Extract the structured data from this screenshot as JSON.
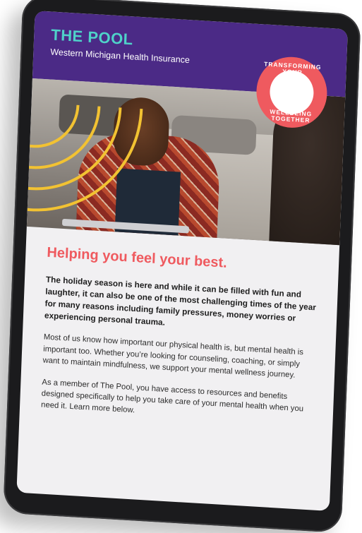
{
  "brand": {
    "name_part1": "THE ",
    "name_part2": "POOL",
    "subtitle": "Western Michigan Health Insurance"
  },
  "badge": {
    "text_top": "TRANSFORMING YOUR",
    "text_bottom": "WELLBEING TOGETHER"
  },
  "article": {
    "headline": "Helping you feel your best.",
    "lead": "The holiday season is here and while it can be filled with fun and laughter, it can also be one of the most challenging times of the year for many reasons including family pressures, money worries or experiencing personal trauma.",
    "paragraphs": [
      "Most of us know how important our physical health is, but mental health is important too. Whether you’re looking for counseling, coaching, or simply want to maintain mindfulness, we support your mental wellness journey.",
      "As a member of The Pool, you have access to resources and benefits designed specifically to help you take care of your mental health when you need it. Learn more below."
    ]
  },
  "colors": {
    "header_purple": "#4b2a86",
    "brand_teal": "#4fd2c9",
    "accent_coral": "#ef5a5f",
    "arc_yellow": "#f2c232"
  }
}
